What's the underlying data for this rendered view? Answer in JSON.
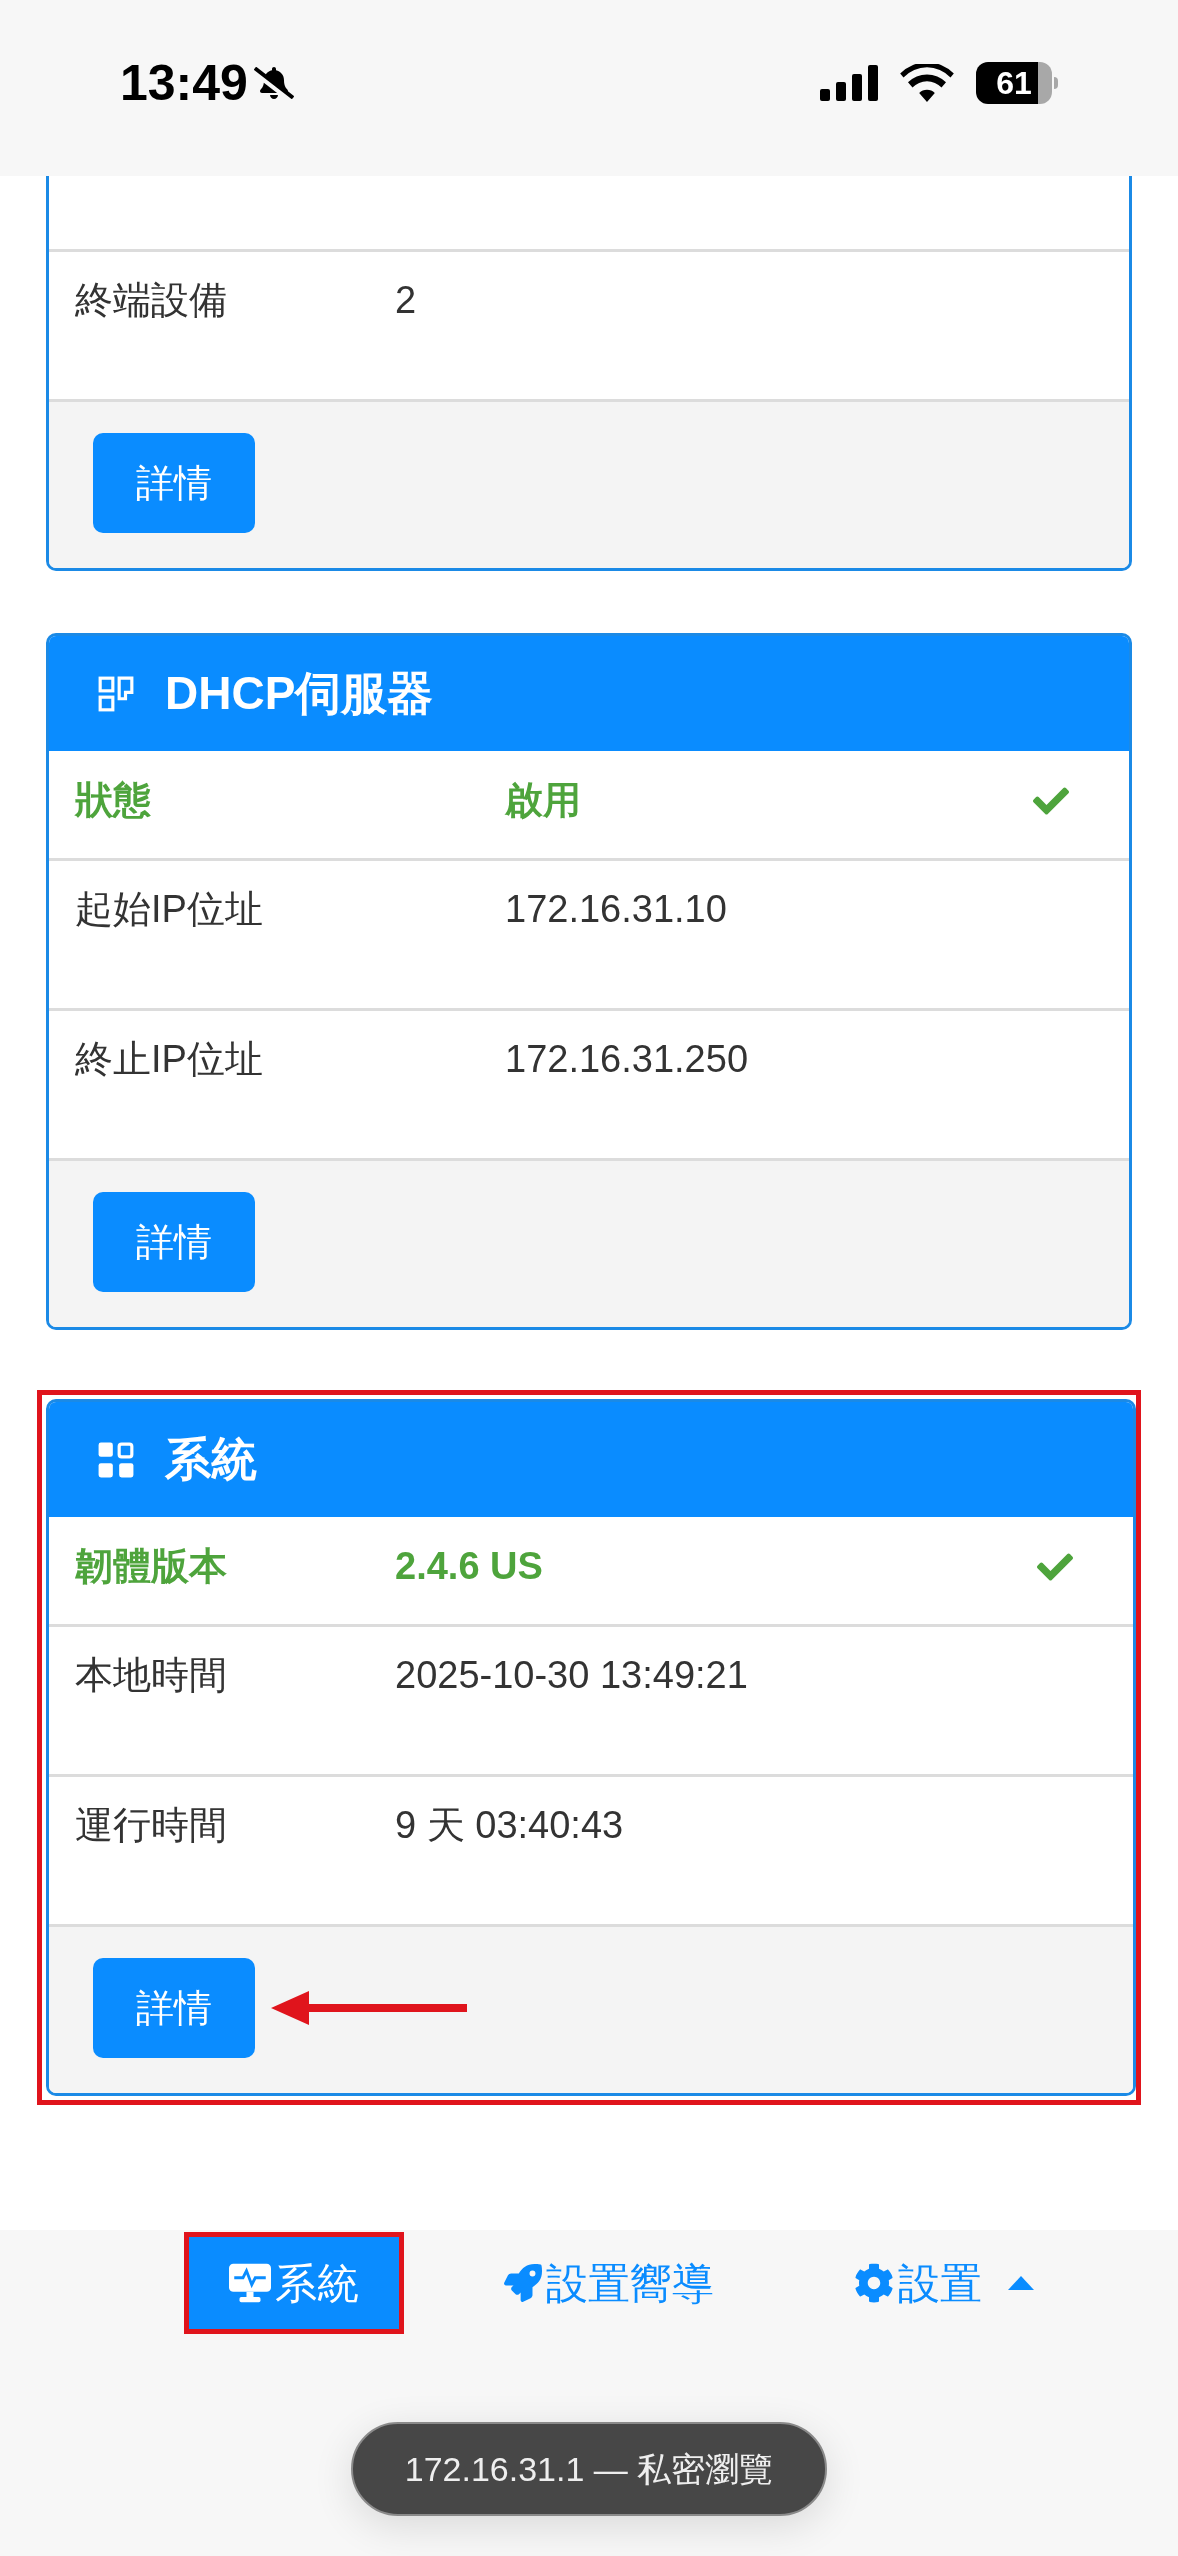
{
  "status_bar": {
    "time": "13:49",
    "silent": true,
    "battery": "61"
  },
  "cards": [
    {
      "kind": "clipped",
      "highlighted": false,
      "rows": [
        {
          "label": "終端設備",
          "value": "2",
          "ok": false
        }
      ],
      "button": "詳情",
      "pointer_arrow": false
    },
    {
      "kind": "dhcp",
      "title": "DHCP伺服器",
      "highlighted": false,
      "rows": [
        {
          "label": "狀態",
          "value": "啟用",
          "ok": true
        },
        {
          "label": "起始IP位址",
          "value": "172.16.31.10",
          "ok": false
        },
        {
          "label": "終止IP位址",
          "value": "172.16.31.250",
          "ok": false
        }
      ],
      "button": "詳情",
      "pointer_arrow": false
    },
    {
      "kind": "system",
      "title": "系統",
      "highlighted": true,
      "rows": [
        {
          "label": "韌體版本",
          "value": "2.4.6 US",
          "ok": true
        },
        {
          "label": "本地時間",
          "value": "2025-10-30 13:49:21",
          "ok": false
        },
        {
          "label": "運行時間",
          "value": "9 天 03:40:43",
          "ok": false
        }
      ],
      "button": "詳情",
      "pointer_arrow": true
    }
  ],
  "nav": [
    {
      "kind": "system",
      "label": "系統",
      "selected": true,
      "highlighted": true
    },
    {
      "kind": "wizard",
      "label": "設置嚮導",
      "selected": false,
      "highlighted": false
    },
    {
      "kind": "settings",
      "label": "設置",
      "selected": false,
      "highlighted": false,
      "dropdown": true
    }
  ],
  "address_bar": {
    "text": "172.16.31.1 — 私密瀏覽"
  }
}
